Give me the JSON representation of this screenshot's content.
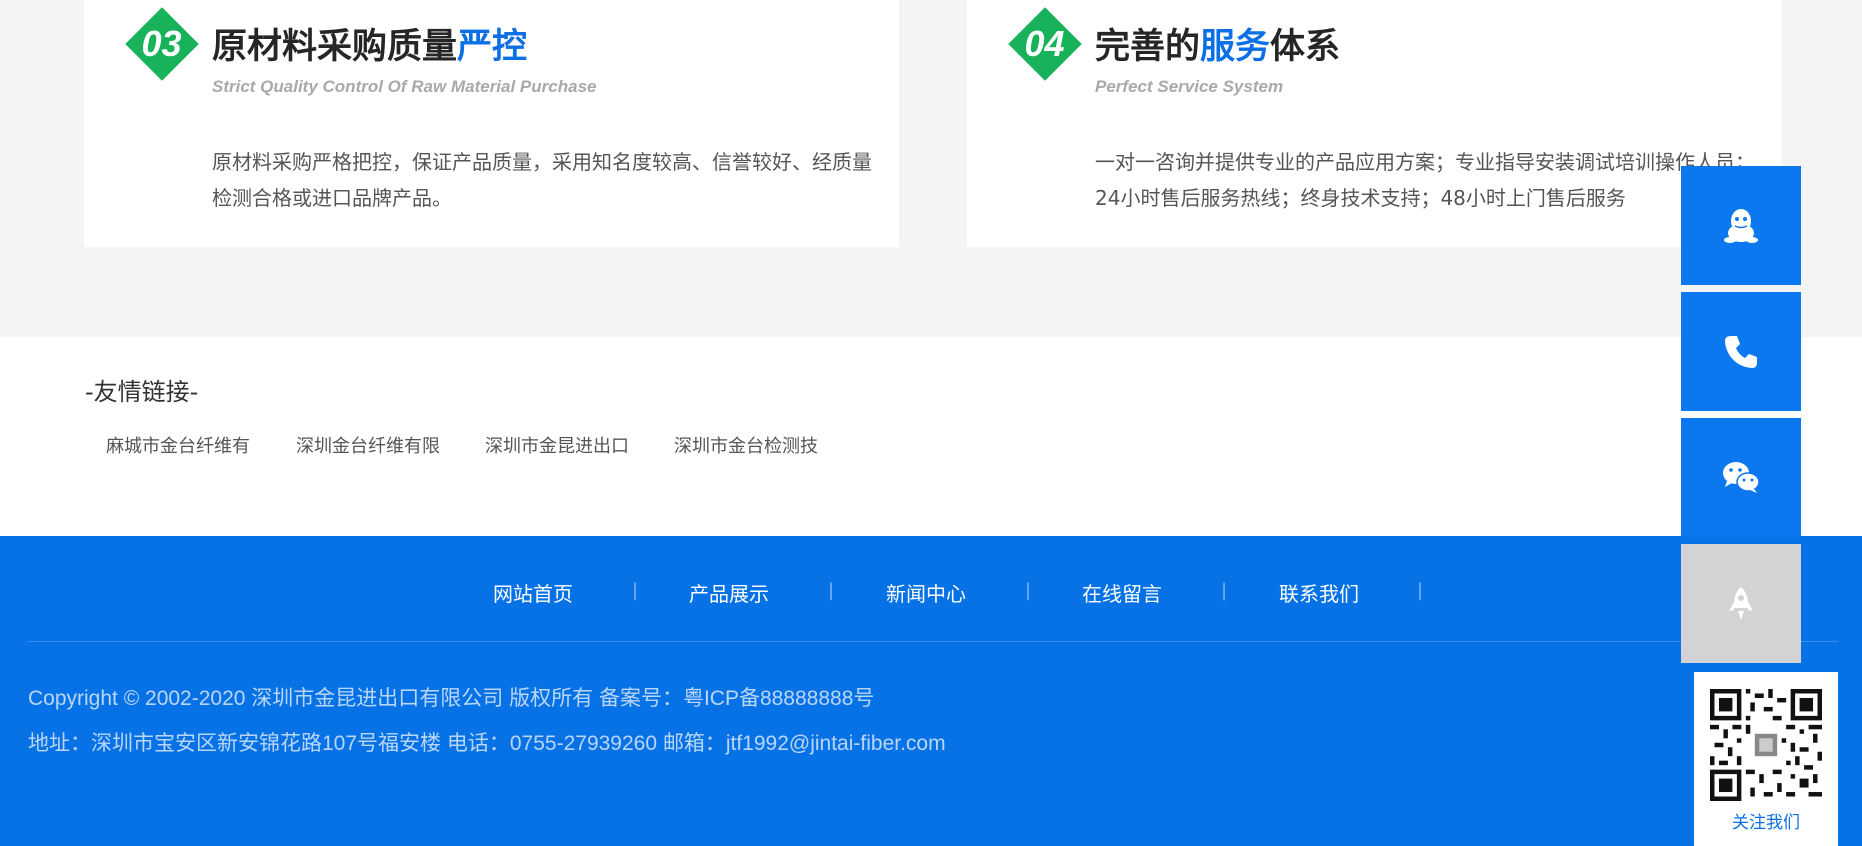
{
  "features": [
    {
      "number": "03",
      "title_main": "原材料采购质量",
      "title_highlight": "严控",
      "title_tail": "",
      "subtitle": "Strict Quality Control Of Raw Material Purchase",
      "description": "原材料采购严格把控，保证产品质量，采用知名度较高、信誉较好、经质量检测合格或进口品牌产品。"
    },
    {
      "number": "04",
      "title_main": "完善的",
      "title_highlight": "服务",
      "title_tail": "体系",
      "subtitle": "Perfect Service System",
      "description": "一对一咨询并提供专业的产品应用方案；专业指导安装调试培训操作人员；24小时售后服务热线；终身技术支持；48小时上门售后服务"
    }
  ],
  "friend_links": {
    "title": "-友情链接-",
    "items": [
      "麻城市金台纤维有",
      "深圳金台纤维有限",
      "深圳市金昆进出口",
      "深圳市金台检测技"
    ]
  },
  "footer": {
    "nav": [
      "网站首页",
      "产品展示",
      "新闻中心",
      "在线留言",
      "联系我们"
    ],
    "separator": "|",
    "copyright": "Copyright © 2002-2020 深圳市金昆进出口有限公司 版权所有  备案号：粤ICP备88888888号",
    "address": "地址：深圳市宝安区新安锦花路107号福安楼 电话：0755-27939260 邮箱：jtf1992@jintai-fiber.com"
  },
  "float_bar": {
    "buttons": [
      {
        "icon": "qq-icon"
      },
      {
        "icon": "phone-icon"
      },
      {
        "icon": "wechat-icon"
      },
      {
        "icon": "rocket-icon"
      }
    ],
    "qr_label": "关注我们"
  },
  "colors": {
    "brand_blue": "#0672e6",
    "highlight_blue": "#0b6fe6",
    "badge_green": "#17b25a",
    "back_to_top_gray": "#d3d3d6"
  }
}
